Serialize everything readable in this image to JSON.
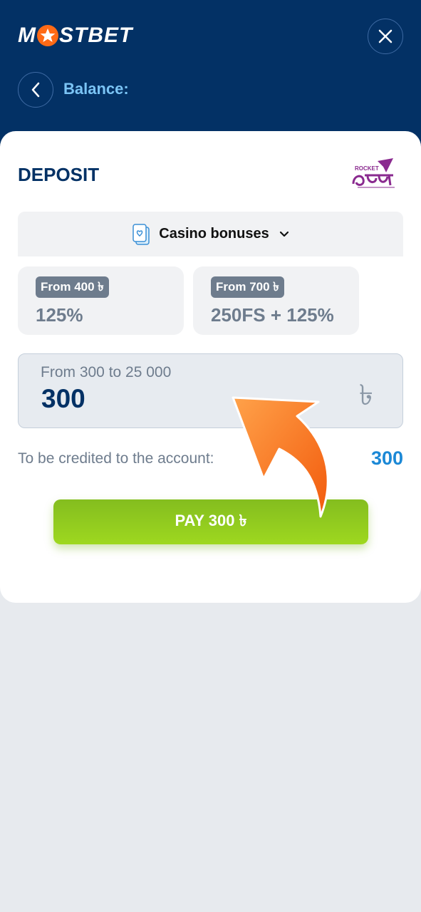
{
  "header": {
    "logo_left": "M",
    "logo_right": "STBET",
    "balance_label": "Balance:"
  },
  "deposit": {
    "title": "DEPOSIT",
    "payment_method_logo": "ROCKET",
    "bonus_selector": {
      "label": "Casino bonuses",
      "icon": "cards-icon"
    },
    "bonuses": [
      {
        "badge": "From 400 ৳",
        "value": "125%"
      },
      {
        "badge": "From 700 ৳",
        "value": "250FS + 125%"
      }
    ],
    "amount": {
      "range_label": "From 300 to 25 000",
      "value": "300",
      "currency_symbol": "৳"
    },
    "credited": {
      "label": "To be credited to the account:",
      "value": "300"
    },
    "pay_button_label": "PAY 300 ৳"
  },
  "colors": {
    "header_bg": "#033165",
    "accent_orange": "#ff6a16",
    "pay_green": "#8cc81f",
    "credited_blue": "#1b88d6"
  }
}
